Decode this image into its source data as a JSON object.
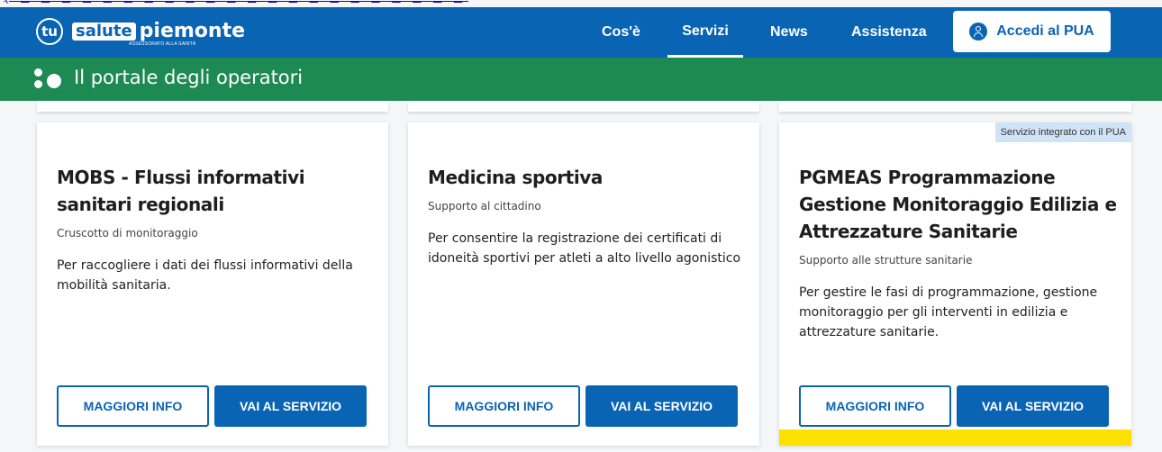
{
  "header": {
    "logo_tu": "tu",
    "logo_salute": "salute",
    "logo_piemonte": "piemonte",
    "logo_subtitle": "ASSESSORATO ALLA SANITÀ",
    "nav": [
      "Cos'è",
      "Servizi",
      "News",
      "Assistenza"
    ],
    "active_nav": "Servizi",
    "login_label": "Accedi al PUA"
  },
  "banner": {
    "title": "Il portale degli operatori"
  },
  "cards": [
    {
      "title": "MOBS - Flussi informativi sanitari regionali",
      "subtitle": "Cruscotto di monitoraggio",
      "description": "Per raccogliere i dati dei flussi informativi della mobilità sanitaria.",
      "info_label": "MAGGIORI INFO",
      "service_label": "VAI AL SERVIZIO"
    },
    {
      "title": "Medicina sportiva",
      "subtitle": "Supporto al cittadino",
      "description": "Per consentire la registrazione dei certificati di idoneità sportivi per atleti a alto livello agonistico",
      "info_label": "MAGGIORI INFO",
      "service_label": "VAI AL SERVIZIO"
    },
    {
      "title": "PGMEAS Programmazione Gestione Monitoraggio Edilizia e Attrezzature Sanitarie",
      "subtitle": "Supporto alle strutture sanitarie",
      "description": "Per gestire le fasi di programmazione, gestione monitoraggio per gli interventi in edilizia e attrezzature sanitarie.",
      "info_label": "MAGGIORI INFO",
      "service_label": "VAI AL SERVIZIO",
      "badge": "Servizio integrato con il PUA"
    }
  ],
  "colors": {
    "primary": "#0a64b4",
    "green": "#1c8a52",
    "highlight": "#ffe100",
    "badge": "#cfe4f6"
  }
}
